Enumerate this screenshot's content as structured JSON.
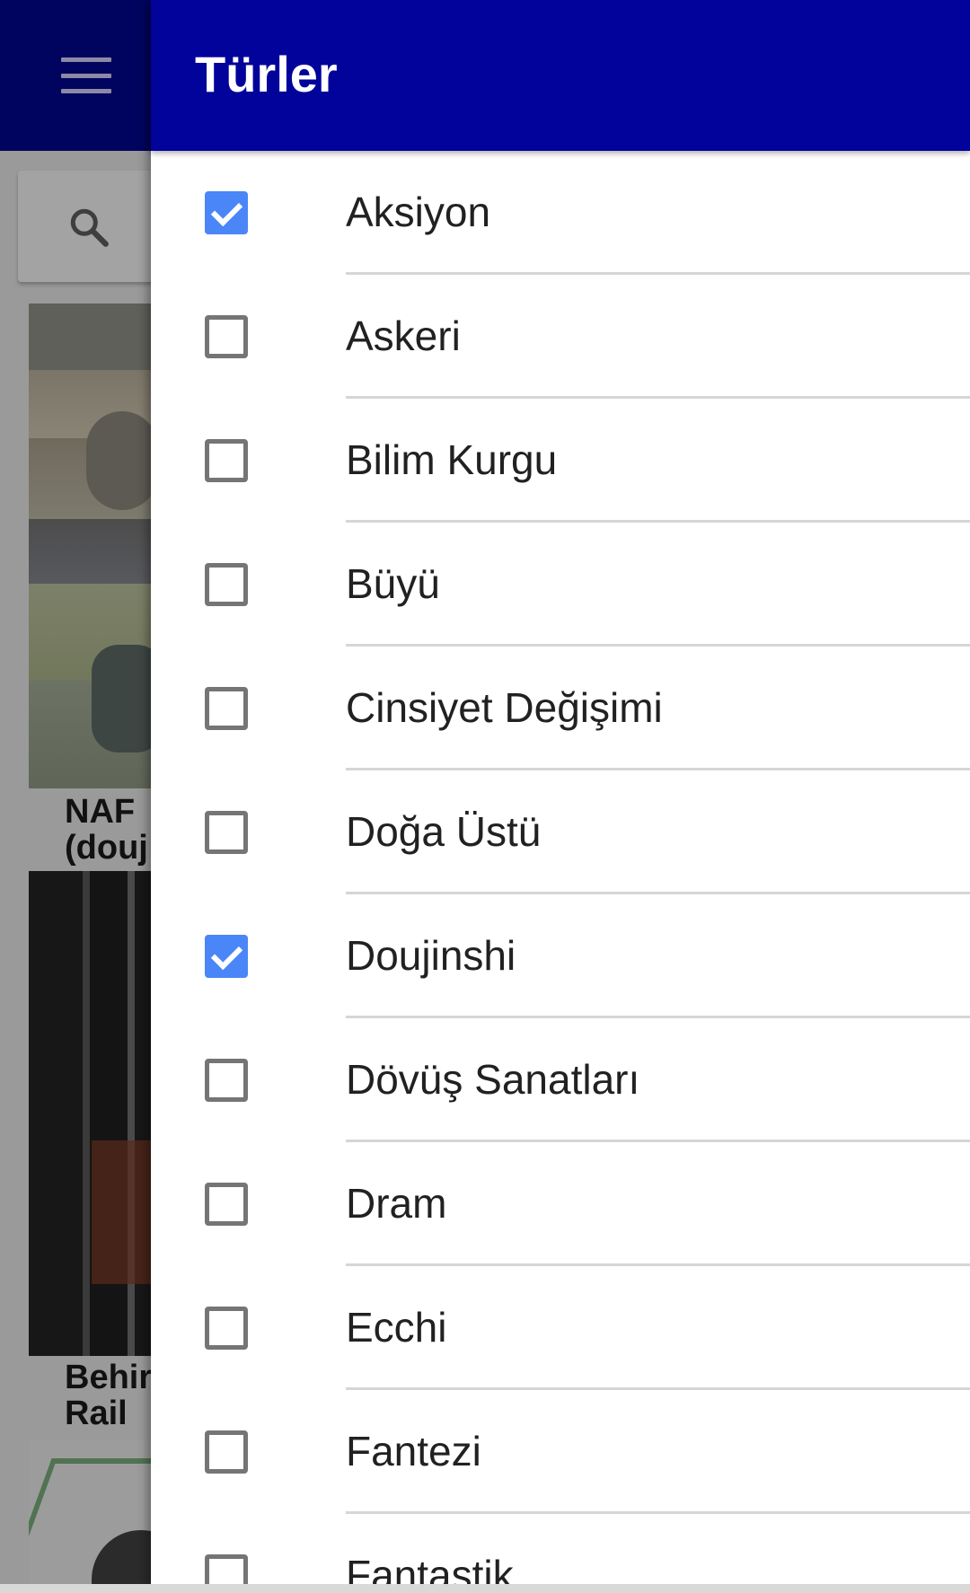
{
  "drawer": {
    "title": "Türler",
    "genres": [
      {
        "label": "Aksiyon",
        "checked": true
      },
      {
        "label": "Askeri",
        "checked": false
      },
      {
        "label": "Bilim Kurgu",
        "checked": false
      },
      {
        "label": "Büyü",
        "checked": false
      },
      {
        "label": "Cinsiyet Değişimi",
        "checked": false
      },
      {
        "label": "Doğa Üstü",
        "checked": false
      },
      {
        "label": "Doujinshi",
        "checked": true
      },
      {
        "label": "Dövüş Sanatları",
        "checked": false
      },
      {
        "label": "Dram",
        "checked": false
      },
      {
        "label": "Ecchi",
        "checked": false
      },
      {
        "label": "Fantezi",
        "checked": false
      },
      {
        "label": "Fantastik",
        "checked": false
      }
    ]
  },
  "background": {
    "menu_icon": "hamburger-menu-icon",
    "search_icon": "search-icon",
    "items": [
      {
        "title": "NAF\n(douj"
      },
      {
        "title": "Behir\nRail"
      }
    ]
  },
  "colors": {
    "appbar": "#01045e",
    "drawer_header": "#01039b",
    "checkbox_checked": "#4a86f7"
  }
}
